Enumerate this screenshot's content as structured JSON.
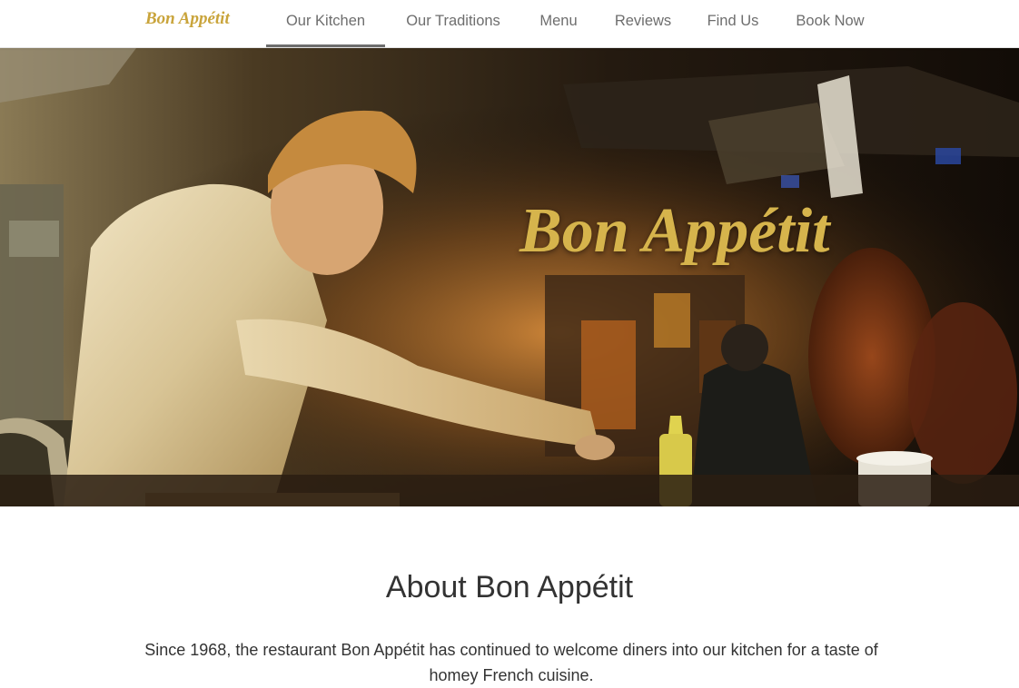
{
  "nav": {
    "brand": "Bon Appétit",
    "items": [
      {
        "label": "Our Kitchen",
        "active": true
      },
      {
        "label": "Our Traditions",
        "active": false
      },
      {
        "label": "Menu",
        "active": false
      },
      {
        "label": "Reviews",
        "active": false
      },
      {
        "label": "Find Us",
        "active": false
      },
      {
        "label": "Book Now",
        "active": false
      }
    ]
  },
  "hero": {
    "title": "Bon Appétit"
  },
  "about": {
    "heading": "About Bon Appétit",
    "text": "Since 1968, the restaurant Bon Appétit has continued to welcome diners into our kitchen for a taste of homey French cuisine."
  },
  "colors": {
    "brand_gold": "#c9a43b",
    "hero_title_gold": "#d6b44c",
    "nav_text": "#6e6e6e",
    "body_text": "#333333"
  }
}
